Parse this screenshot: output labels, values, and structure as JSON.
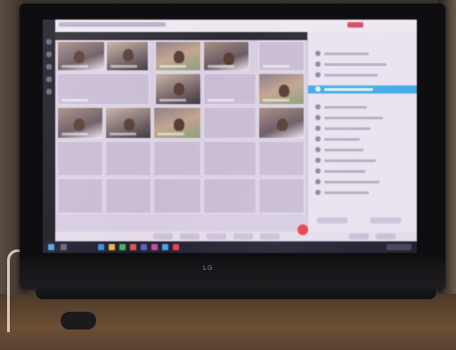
{
  "monitor": {
    "brand": "LG"
  },
  "app": {
    "window_title": "",
    "panel_title": "",
    "participants": [
      {
        "name": ""
      },
      {
        "name": ""
      },
      {
        "name": ""
      },
      {
        "name": ""
      },
      {
        "name": ""
      },
      {
        "name": ""
      },
      {
        "name": ""
      },
      {
        "name": ""
      },
      {
        "name": ""
      },
      {
        "name": ""
      },
      {
        "name": ""
      },
      {
        "name": ""
      }
    ],
    "controls": [
      {
        "icon": "mic-icon"
      },
      {
        "icon": "camera-icon"
      },
      {
        "icon": "share-screen-icon"
      },
      {
        "icon": "chat-icon"
      },
      {
        "icon": "participants-icon"
      },
      {
        "icon": "more-icon"
      },
      {
        "icon": "leave-call-icon",
        "color": "#e8404f"
      }
    ]
  },
  "colors": {
    "selected_row": "#3fa9e6",
    "leave_button": "#e8404f",
    "taskbar": "#242131"
  }
}
